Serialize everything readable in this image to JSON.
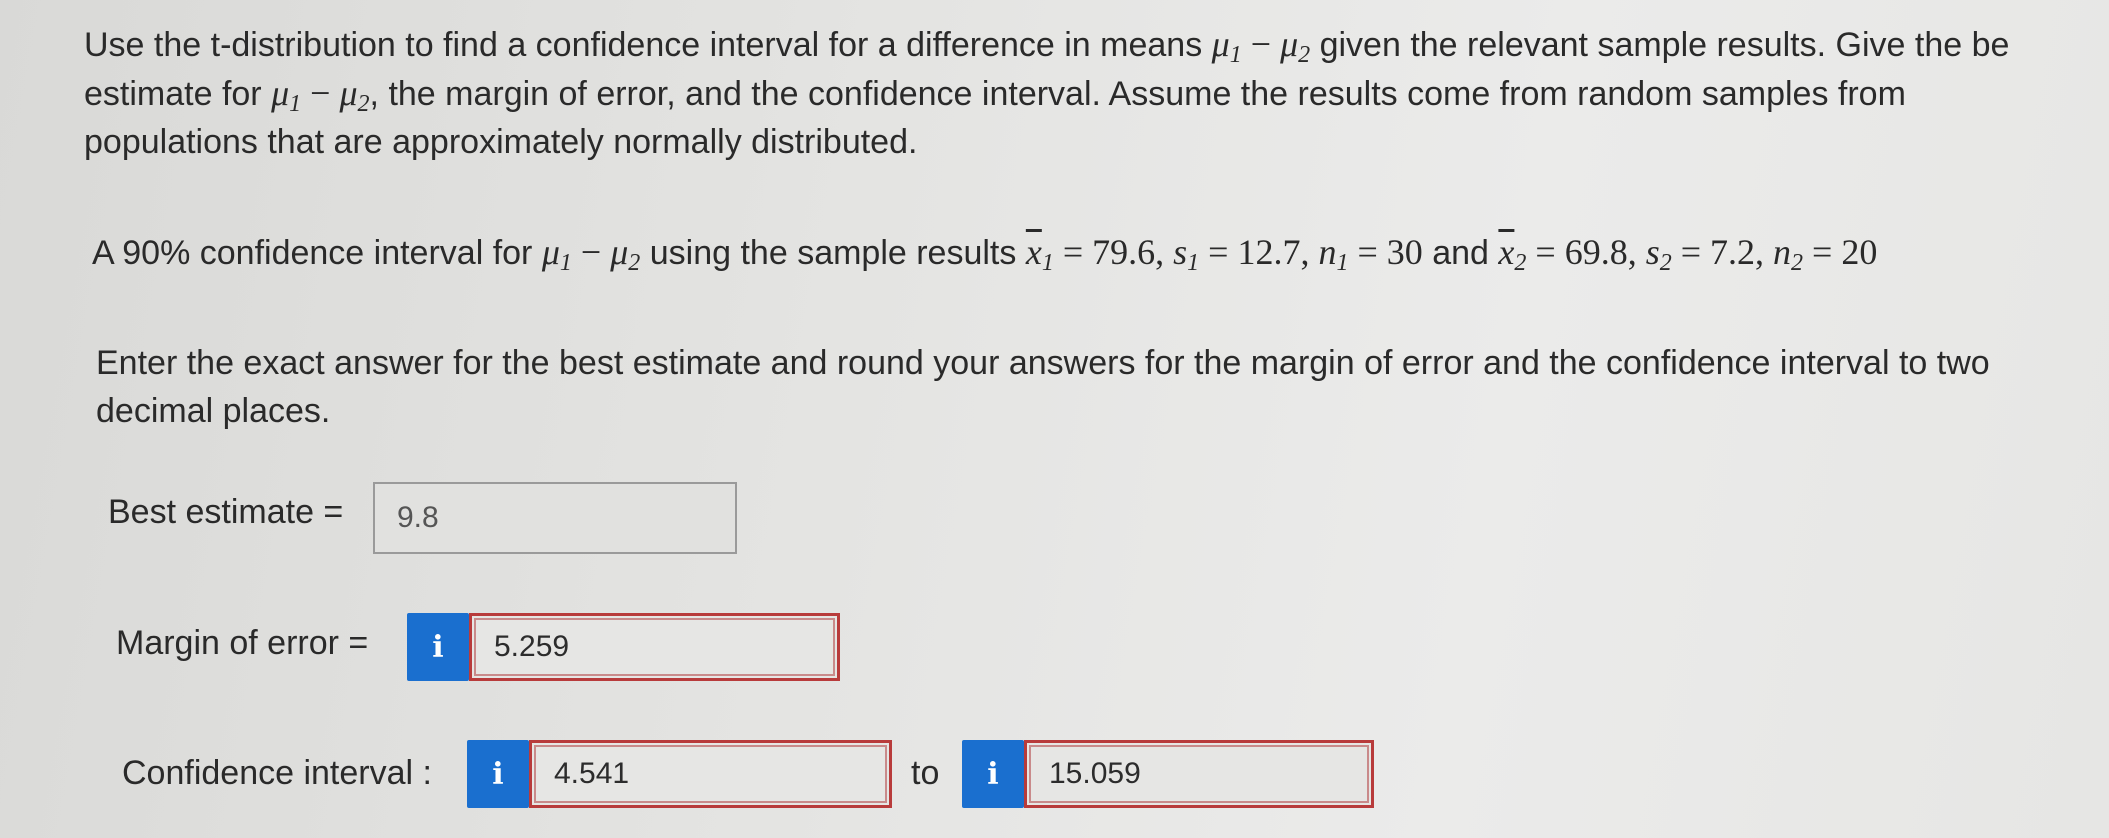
{
  "question": {
    "intro_lines": [
      "Use the t-distribution to find a confidence interval for a difference in means",
      "given the relevant sample results. Give the be",
      "estimate for",
      ", the margin of error, and the confidence interval. Assume the results come from random samples from",
      "populations that are approximately normally distributed."
    ],
    "math": {
      "mu1": "μ",
      "mu2": "μ",
      "minus": " − ",
      "sub1": "1",
      "sub2": "2"
    },
    "setup": {
      "lead": "A 90% confidence interval for",
      "middle": "using the sample results",
      "xbar": "x",
      "s": "s",
      "n": "n",
      "x1_value": " = 79.6, ",
      "s1_value": " = 12.7, ",
      "n1_value": " = 30",
      "and": " and ",
      "x2_value": " = 69.8, ",
      "s2_value": " = 7.2, ",
      "n2_value": " = 20"
    },
    "instructions_lines": [
      "Enter the exact answer for the best estimate and round your answers for the margin of error and the confidence interval to two",
      "decimal places."
    ]
  },
  "answers": {
    "best_estimate_label": "Best estimate =",
    "best_estimate_value": "9.8",
    "margin_label": "Margin of error =",
    "margin_value": "5.259",
    "ci_label": "Confidence interval :",
    "ci_lower": "4.541",
    "to_label": "to",
    "ci_upper": "15.059",
    "info_glyph": "i"
  },
  "colors": {
    "info_button": "#1a6fcf",
    "error_border": "#b83b3b",
    "background": "#e4e4e2"
  }
}
